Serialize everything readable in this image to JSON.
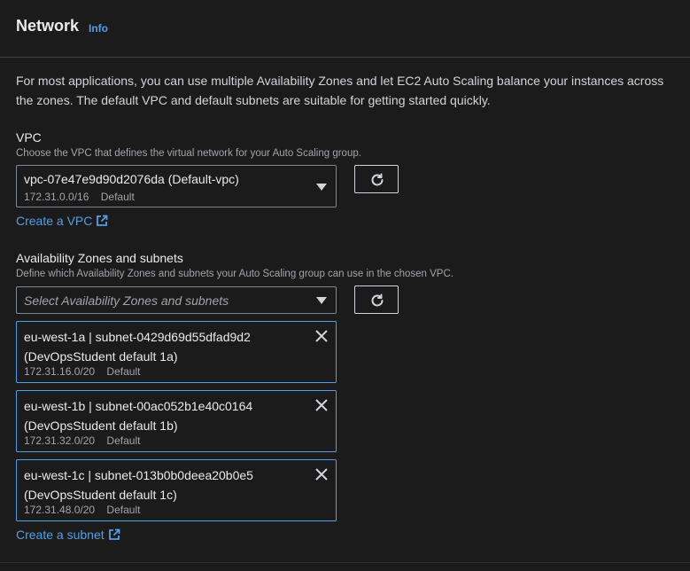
{
  "colors": {
    "background": "#1b1b1c",
    "link": "#539fe5",
    "token_border": "#539fe5"
  },
  "header": {
    "title": "Network",
    "info": "Info"
  },
  "intro": "For most applications, you can use multiple Availability Zones and let EC2 Auto Scaling balance your instances across the zones. The default VPC and default subnets are suitable for getting started quickly.",
  "vpc": {
    "label": "VPC",
    "description": "Choose the VPC that defines the virtual network for your Auto Scaling group.",
    "selected": "vpc-07e47e9d90d2076da (Default-vpc)",
    "cidr": "172.31.0.0/16",
    "tag": "Default",
    "create_link": "Create a VPC",
    "refresh_icon": "refresh-icon",
    "caret_icon": "caret-down-icon"
  },
  "subnets": {
    "label": "Availability Zones and subnets",
    "description": "Define which Availability Zones and subnets your Auto Scaling group can use in the chosen VPC.",
    "placeholder": "Select Availability Zones and subnets",
    "create_link": "Create a subnet",
    "tokens": [
      {
        "line1": "eu-west-1a | subnet-0429d69d55dfad9d2",
        "line2": "(DevOpsStudent default 1a)",
        "cidr": "172.31.16.0/20",
        "tag": "Default"
      },
      {
        "line1": "eu-west-1b | subnet-00ac052b1e40c0164",
        "line2": "(DevOpsStudent default 1b)",
        "cidr": "172.31.32.0/20",
        "tag": "Default"
      },
      {
        "line1": "eu-west-1c | subnet-013b0b0deea20b0e5",
        "line2": "(DevOpsStudent default 1c)",
        "cidr": "172.31.48.0/20",
        "tag": "Default"
      }
    ]
  }
}
